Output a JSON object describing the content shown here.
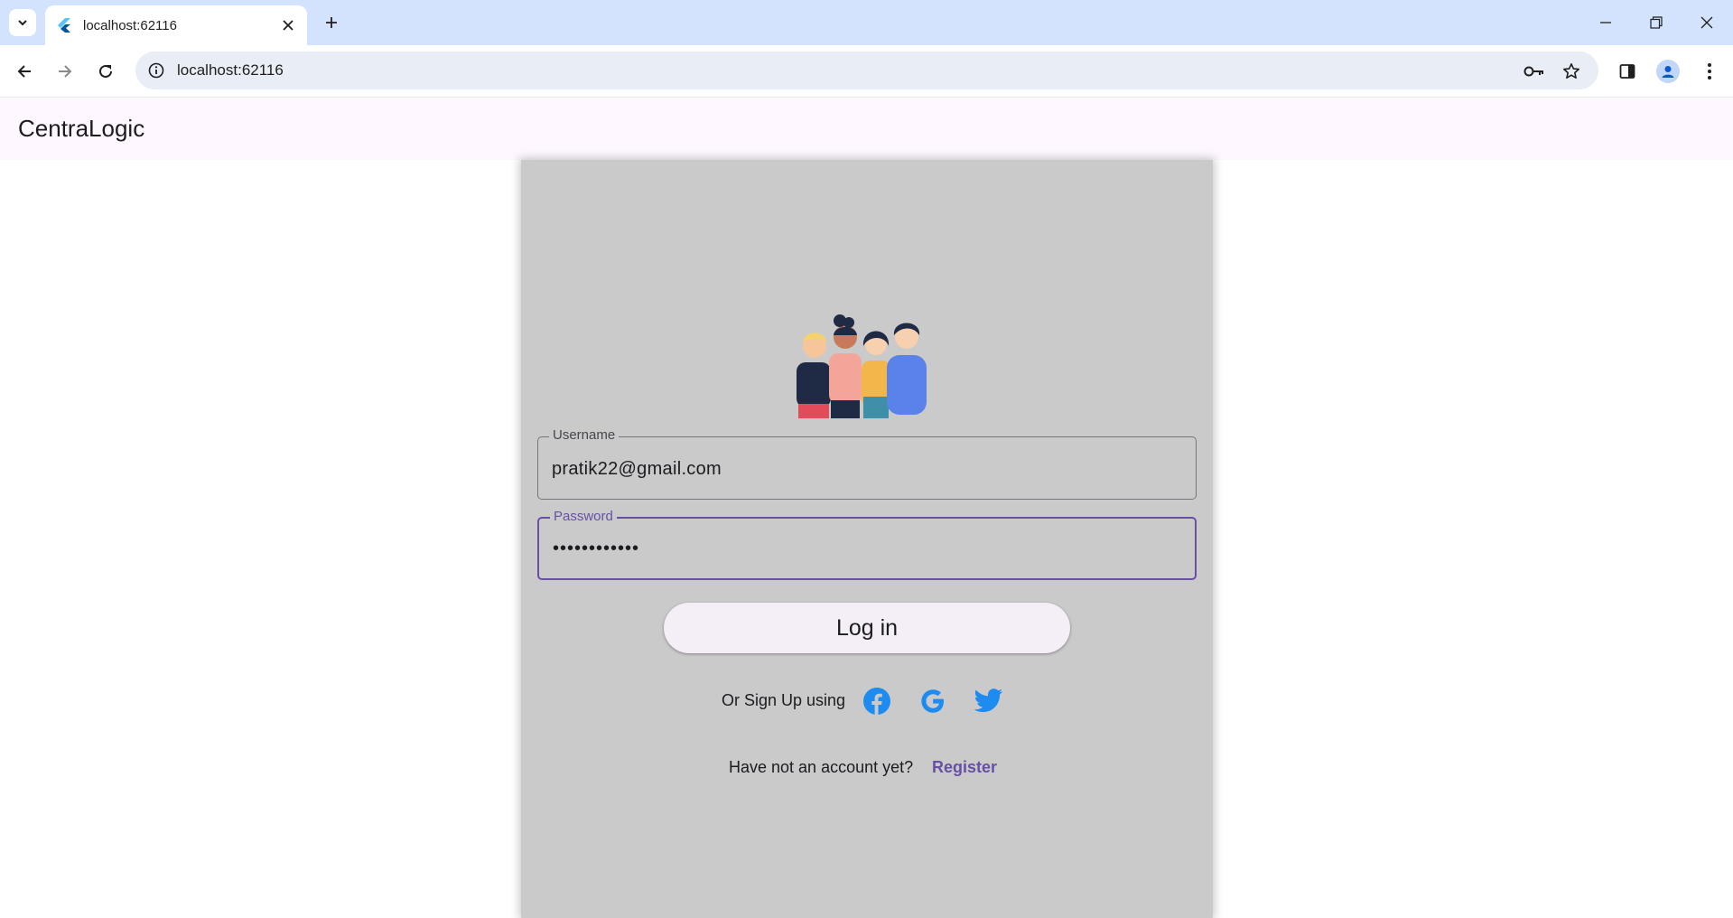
{
  "browser": {
    "tab_title": "localhost:62116",
    "url": "localhost:62116"
  },
  "app": {
    "title": "CentraLogic"
  },
  "login": {
    "username_label": "Username",
    "username_value": "pratik22@gmail.com",
    "password_label": "Password",
    "password_value": "••••••••••••",
    "login_button": "Log in",
    "signup_text": "Or Sign Up using",
    "no_account_text": "Have not an account yet?",
    "register_link": "Register"
  },
  "colors": {
    "tabstrip": "#d3e3fd",
    "appbar": "#fef7ff",
    "panel": "#cacaca",
    "accent": "#6750a4",
    "social_blue": "#1d8bf0"
  },
  "icons": [
    "chevron-down-icon",
    "flutter-icon",
    "close-icon",
    "plus-icon",
    "minimize-icon",
    "restore-icon",
    "back-icon",
    "forward-icon",
    "reload-icon",
    "info-icon",
    "key-icon",
    "star-icon",
    "side-panel-icon",
    "profile-icon",
    "kebab-menu-icon",
    "facebook-icon",
    "google-icon",
    "twitter-icon"
  ]
}
